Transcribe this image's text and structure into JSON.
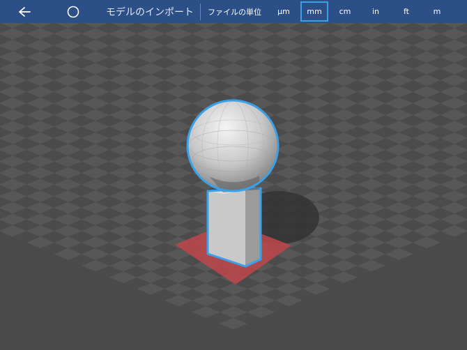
{
  "toolbar": {
    "title": "モデルのインポート",
    "units_label": "ファイルの単位",
    "units": [
      "μm",
      "mm",
      "cm",
      "in",
      "ft",
      "m"
    ],
    "selected_unit": "mm",
    "back_icon": "arrow-left-icon",
    "home_icon": "circle-icon"
  },
  "colors": {
    "toolbar_bg": "#2b4f86",
    "selection_outline": "#3aa0e8",
    "base_highlight": "#c0464b",
    "floor_dark": "#4b4b4b",
    "floor_light": "#5a5a5a"
  }
}
